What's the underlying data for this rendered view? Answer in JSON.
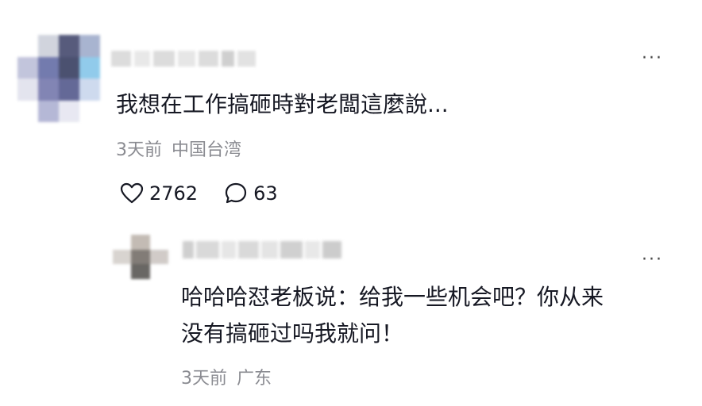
{
  "comment": {
    "text": "我想在工作搞砸時對老闆這麼說...",
    "time": "3天前",
    "location": "中国台湾",
    "more_label": "···",
    "likes": "2762",
    "replies": "63",
    "like_icon": "heart-outline-icon",
    "reply_icon": "speech-bubble-icon"
  },
  "reply": {
    "text_line1": "哈哈哈怼老板说：给我一些机会吧？你从来",
    "text_line2": "没有搞砸过吗我就问！",
    "time": "3天前",
    "location": "广东",
    "more_label": "···"
  },
  "colors": {
    "text": "#161823",
    "meta": "#8a8b91",
    "background": "#ffffff"
  }
}
